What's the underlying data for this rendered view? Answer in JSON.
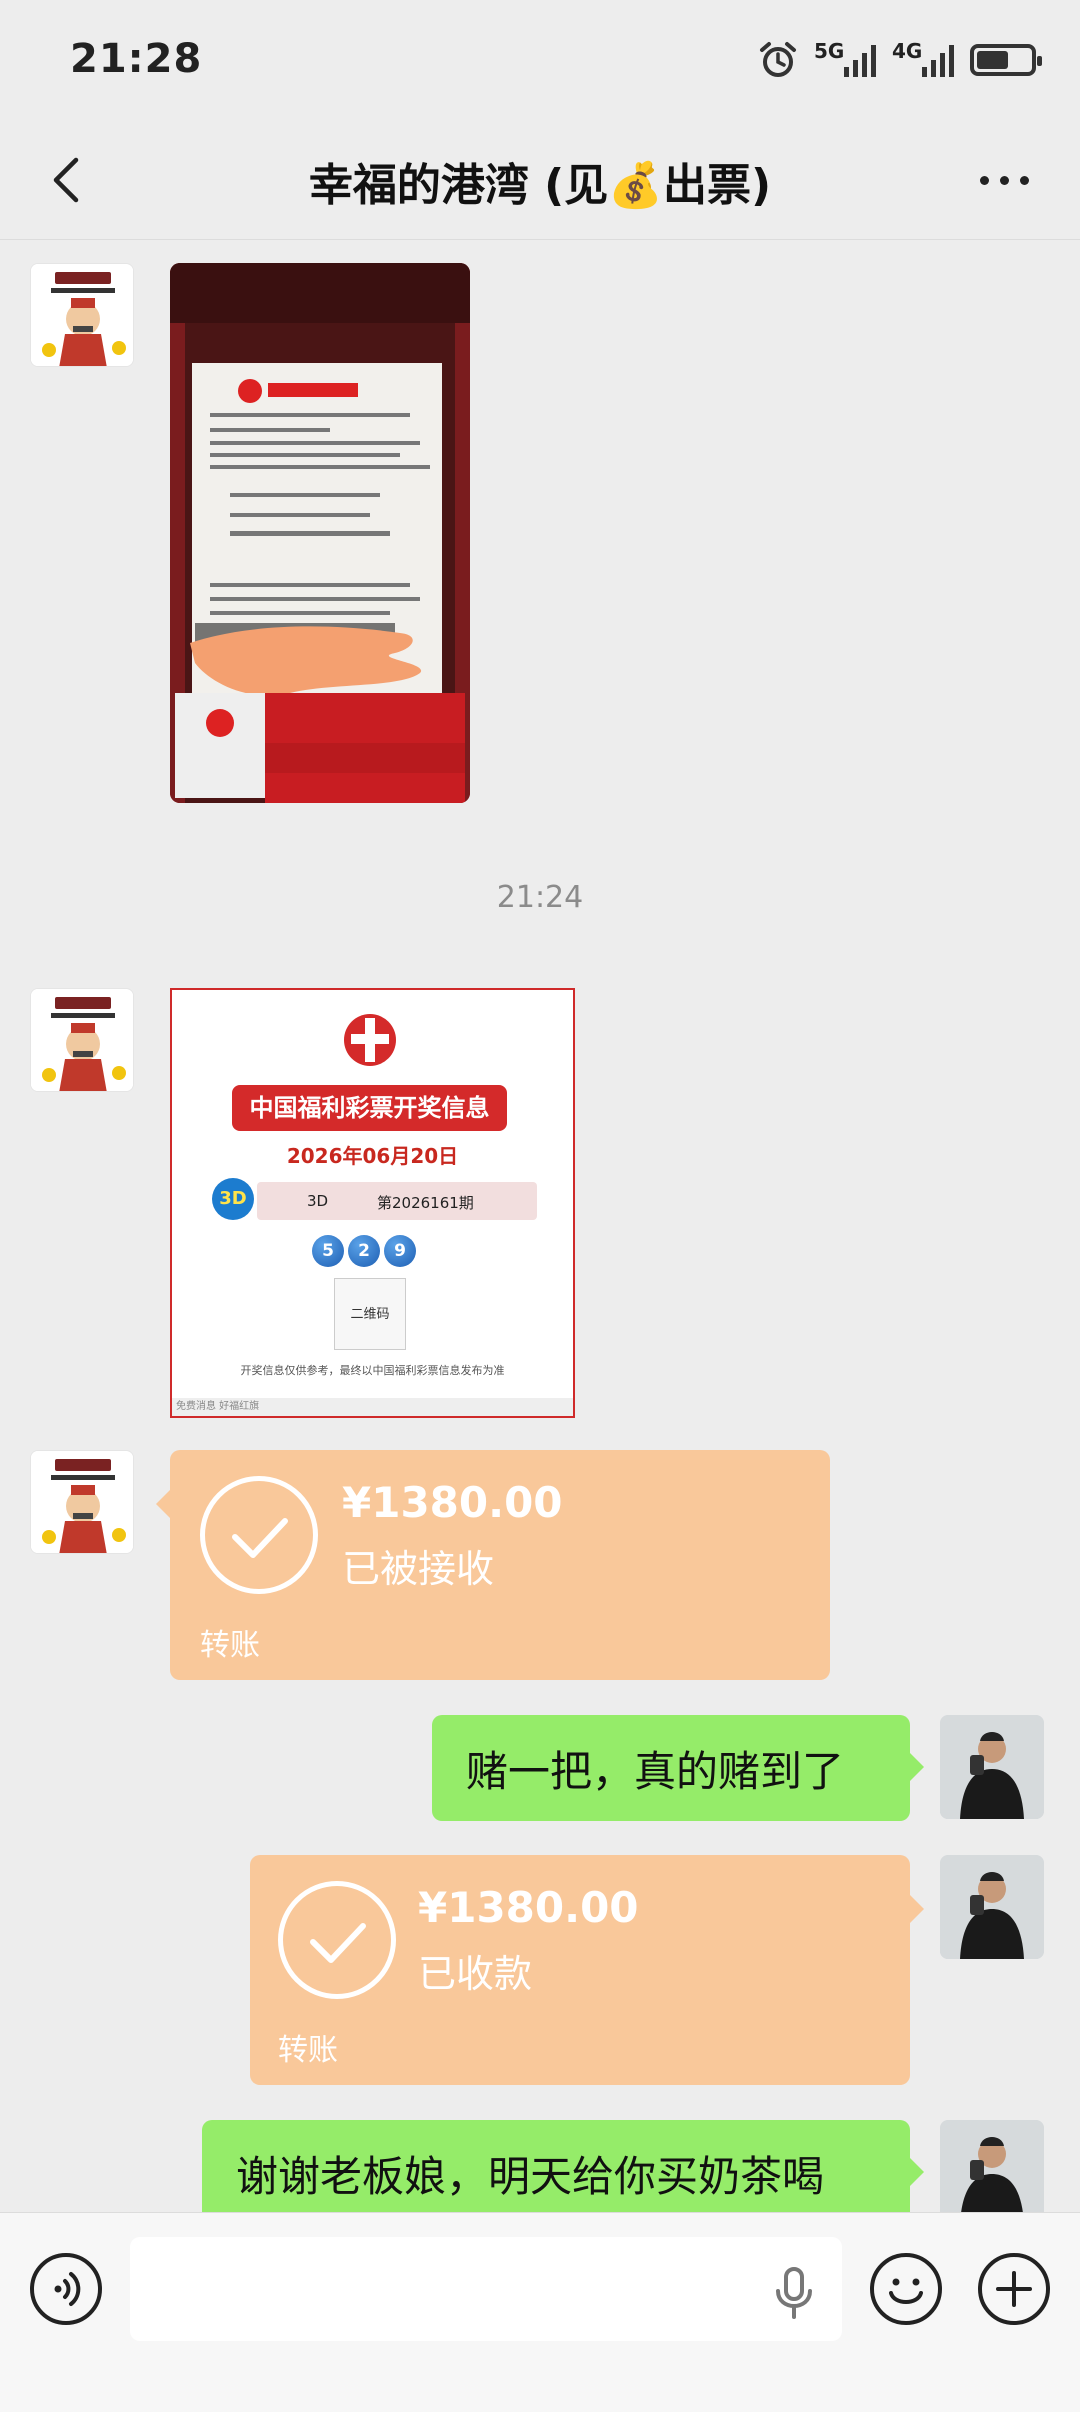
{
  "status_bar": {
    "time": "21:28",
    "net1": "5G",
    "net2": "4G",
    "battery_level": 0.6
  },
  "nav": {
    "title": "幸福的港湾 (见💰出票)"
  },
  "messages": {
    "timestamp": "21:24",
    "lottery_card": {
      "banner": "中国福利彩票开奖信息",
      "date": "2026年06月20日",
      "game": "3D",
      "period": "第2026161期",
      "balls": [
        "5",
        "2",
        "9"
      ],
      "qr_label": "二维码",
      "note": "开奖信息仅供参考，最终以中国福利彩票信息发布为准",
      "footer": "免费消息  好福红旗"
    },
    "transfer_received": {
      "amount": "¥1380.00",
      "status": "已被接收",
      "kind": "转账"
    },
    "text1": "赌一把，真的赌到了",
    "transfer_sent": {
      "amount": "¥1380.00",
      "status": "已收款",
      "kind": "转账"
    },
    "text2": "谢谢老板娘，明天给你买奶茶喝"
  },
  "input_bar": {
    "placeholder": ""
  },
  "colors": {
    "green_bubble": "#95ec69",
    "transfer": "#f9c89a",
    "background": "#ededed"
  }
}
